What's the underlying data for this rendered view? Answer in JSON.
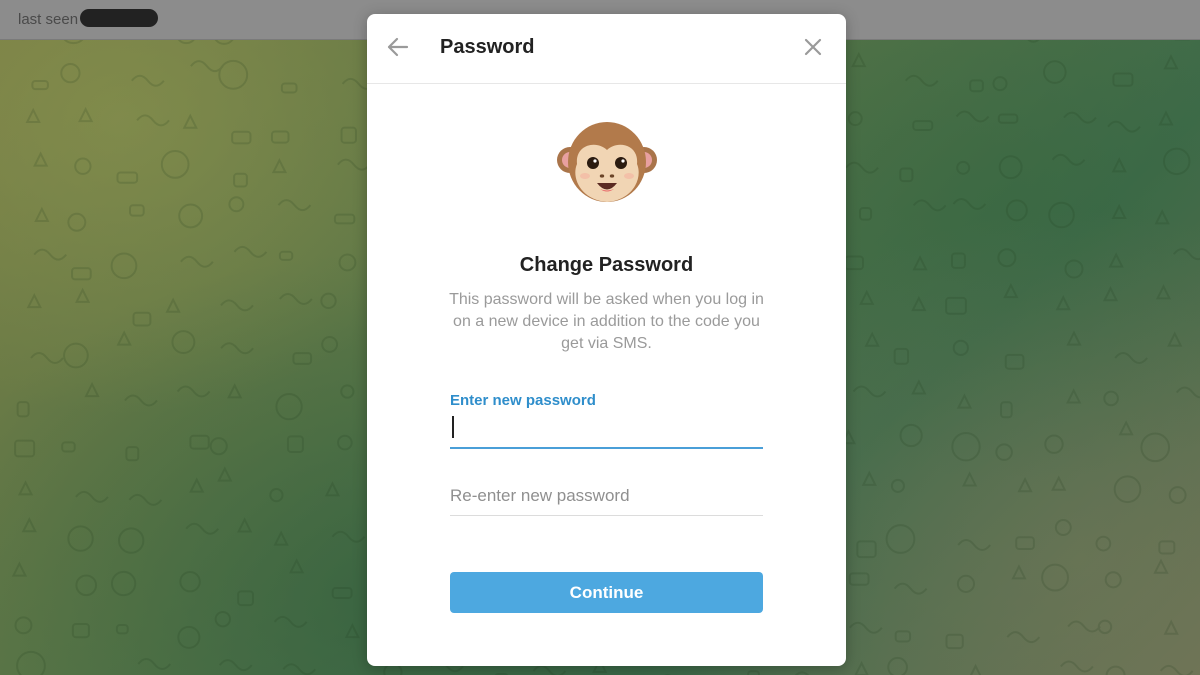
{
  "chat": {
    "contact_name": "",
    "status": "last seen"
  },
  "dialog": {
    "title": "Password",
    "heading": "Change Password",
    "description": "This password will be asked when you log in on a new device in addition to the code you get via SMS.",
    "new_password": {
      "label": "Enter new password",
      "value": ""
    },
    "confirm_password": {
      "placeholder": "Re-enter new password",
      "value": ""
    },
    "continue_label": "Continue",
    "icons": {
      "back": "arrow-left-icon",
      "close": "close-icon",
      "illustration": "monkey-icon"
    }
  },
  "colors": {
    "accent": "#4da8e0",
    "field_label": "#2f8ecb",
    "dim_overlay": "#8c8c8c"
  }
}
